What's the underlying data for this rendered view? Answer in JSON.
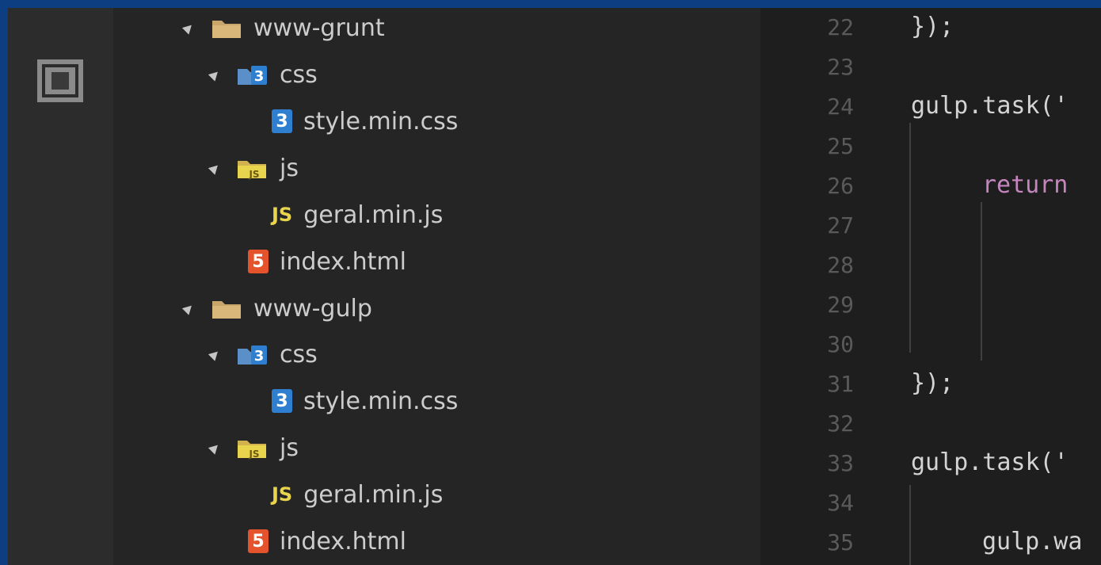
{
  "explorer": {
    "items": [
      {
        "label": "www-grunt",
        "kind": "folder"
      },
      {
        "label": "css",
        "kind": "css-folder"
      },
      {
        "label": "style.min.css",
        "kind": "css-file"
      },
      {
        "label": "js",
        "kind": "js-folder"
      },
      {
        "label": "geral.min.js",
        "kind": "js-file"
      },
      {
        "label": "index.html",
        "kind": "html-file"
      },
      {
        "label": "www-gulp",
        "kind": "folder"
      },
      {
        "label": "css",
        "kind": "css-folder"
      },
      {
        "label": "style.min.css",
        "kind": "css-file"
      },
      {
        "label": "js",
        "kind": "js-folder"
      },
      {
        "label": "geral.min.js",
        "kind": "js-file"
      },
      {
        "label": "index.html",
        "kind": "html-file"
      }
    ],
    "icon_glyphs": {
      "css": "3",
      "html": "5",
      "js": "JS"
    }
  },
  "editor": {
    "line_numbers": [
      "22",
      "23",
      "24",
      "25",
      "26",
      "27",
      "28",
      "29",
      "30",
      "31",
      "32",
      "33",
      "34",
      "35"
    ],
    "lines": [
      "});",
      "",
      "gulp.task('",
      "",
      "return",
      "",
      "",
      "",
      "",
      "});",
      "",
      "gulp.task('",
      "",
      "gulp.wa"
    ]
  },
  "colors": {
    "background_frame": "#0e3e82",
    "sidebar": "#252526",
    "editor": "#1e1e1e",
    "keyword": "#c586c0",
    "css_icon": "#2f7fd1",
    "html_icon": "#e5532d",
    "js_icon": "#e8d44d",
    "folder": "#c8a66b"
  }
}
